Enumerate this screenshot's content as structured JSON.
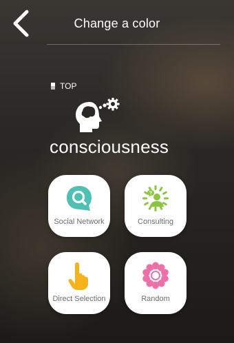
{
  "header": {
    "title": "Change a color"
  },
  "section": {
    "label": "TOP",
    "title": "consciousness"
  },
  "options": [
    {
      "label": "Social Network",
      "icon": "chat-search-icon",
      "color": "#4fc1b4"
    },
    {
      "label": "Consulting",
      "icon": "consultant-icon",
      "color": "#8cc63f"
    },
    {
      "label": "Direct Selection",
      "icon": "pointing-hand-icon",
      "color": "#f5b21a"
    },
    {
      "label": "Random",
      "icon": "random-flower-icon",
      "color": "#ef6fa8"
    }
  ]
}
